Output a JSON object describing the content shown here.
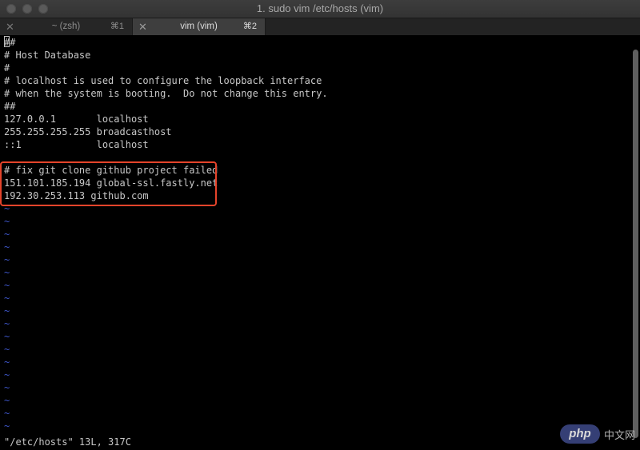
{
  "window": {
    "title": "1. sudo vim /etc/hosts (vim)"
  },
  "tabs": [
    {
      "label": "~ (zsh)",
      "shortcut": "⌘1",
      "active": false
    },
    {
      "label": "vim (vim)",
      "shortcut": "⌘2",
      "active": true
    }
  ],
  "editor": {
    "lines": [
      "##",
      "# Host Database",
      "#",
      "# localhost is used to configure the loopback interface",
      "# when the system is booting.  Do not change this entry.",
      "##",
      "127.0.0.1       localhost",
      "255.255.255.255 broadcasthost",
      "::1             localhost",
      "",
      "# fix git clone github project failed",
      "151.101.185.194 global-ssl.fastly.net",
      "192.30.253.113 github.com"
    ],
    "empty_line_marker": "~",
    "status": "\"/etc/hosts\" 13L, 317C"
  },
  "colors": {
    "background": "#000000",
    "text": "#c7c7c7",
    "tilde": "#3d55c8",
    "highlight_box": "#e5442b"
  },
  "watermark": {
    "badge": "php",
    "text": "中文网"
  }
}
